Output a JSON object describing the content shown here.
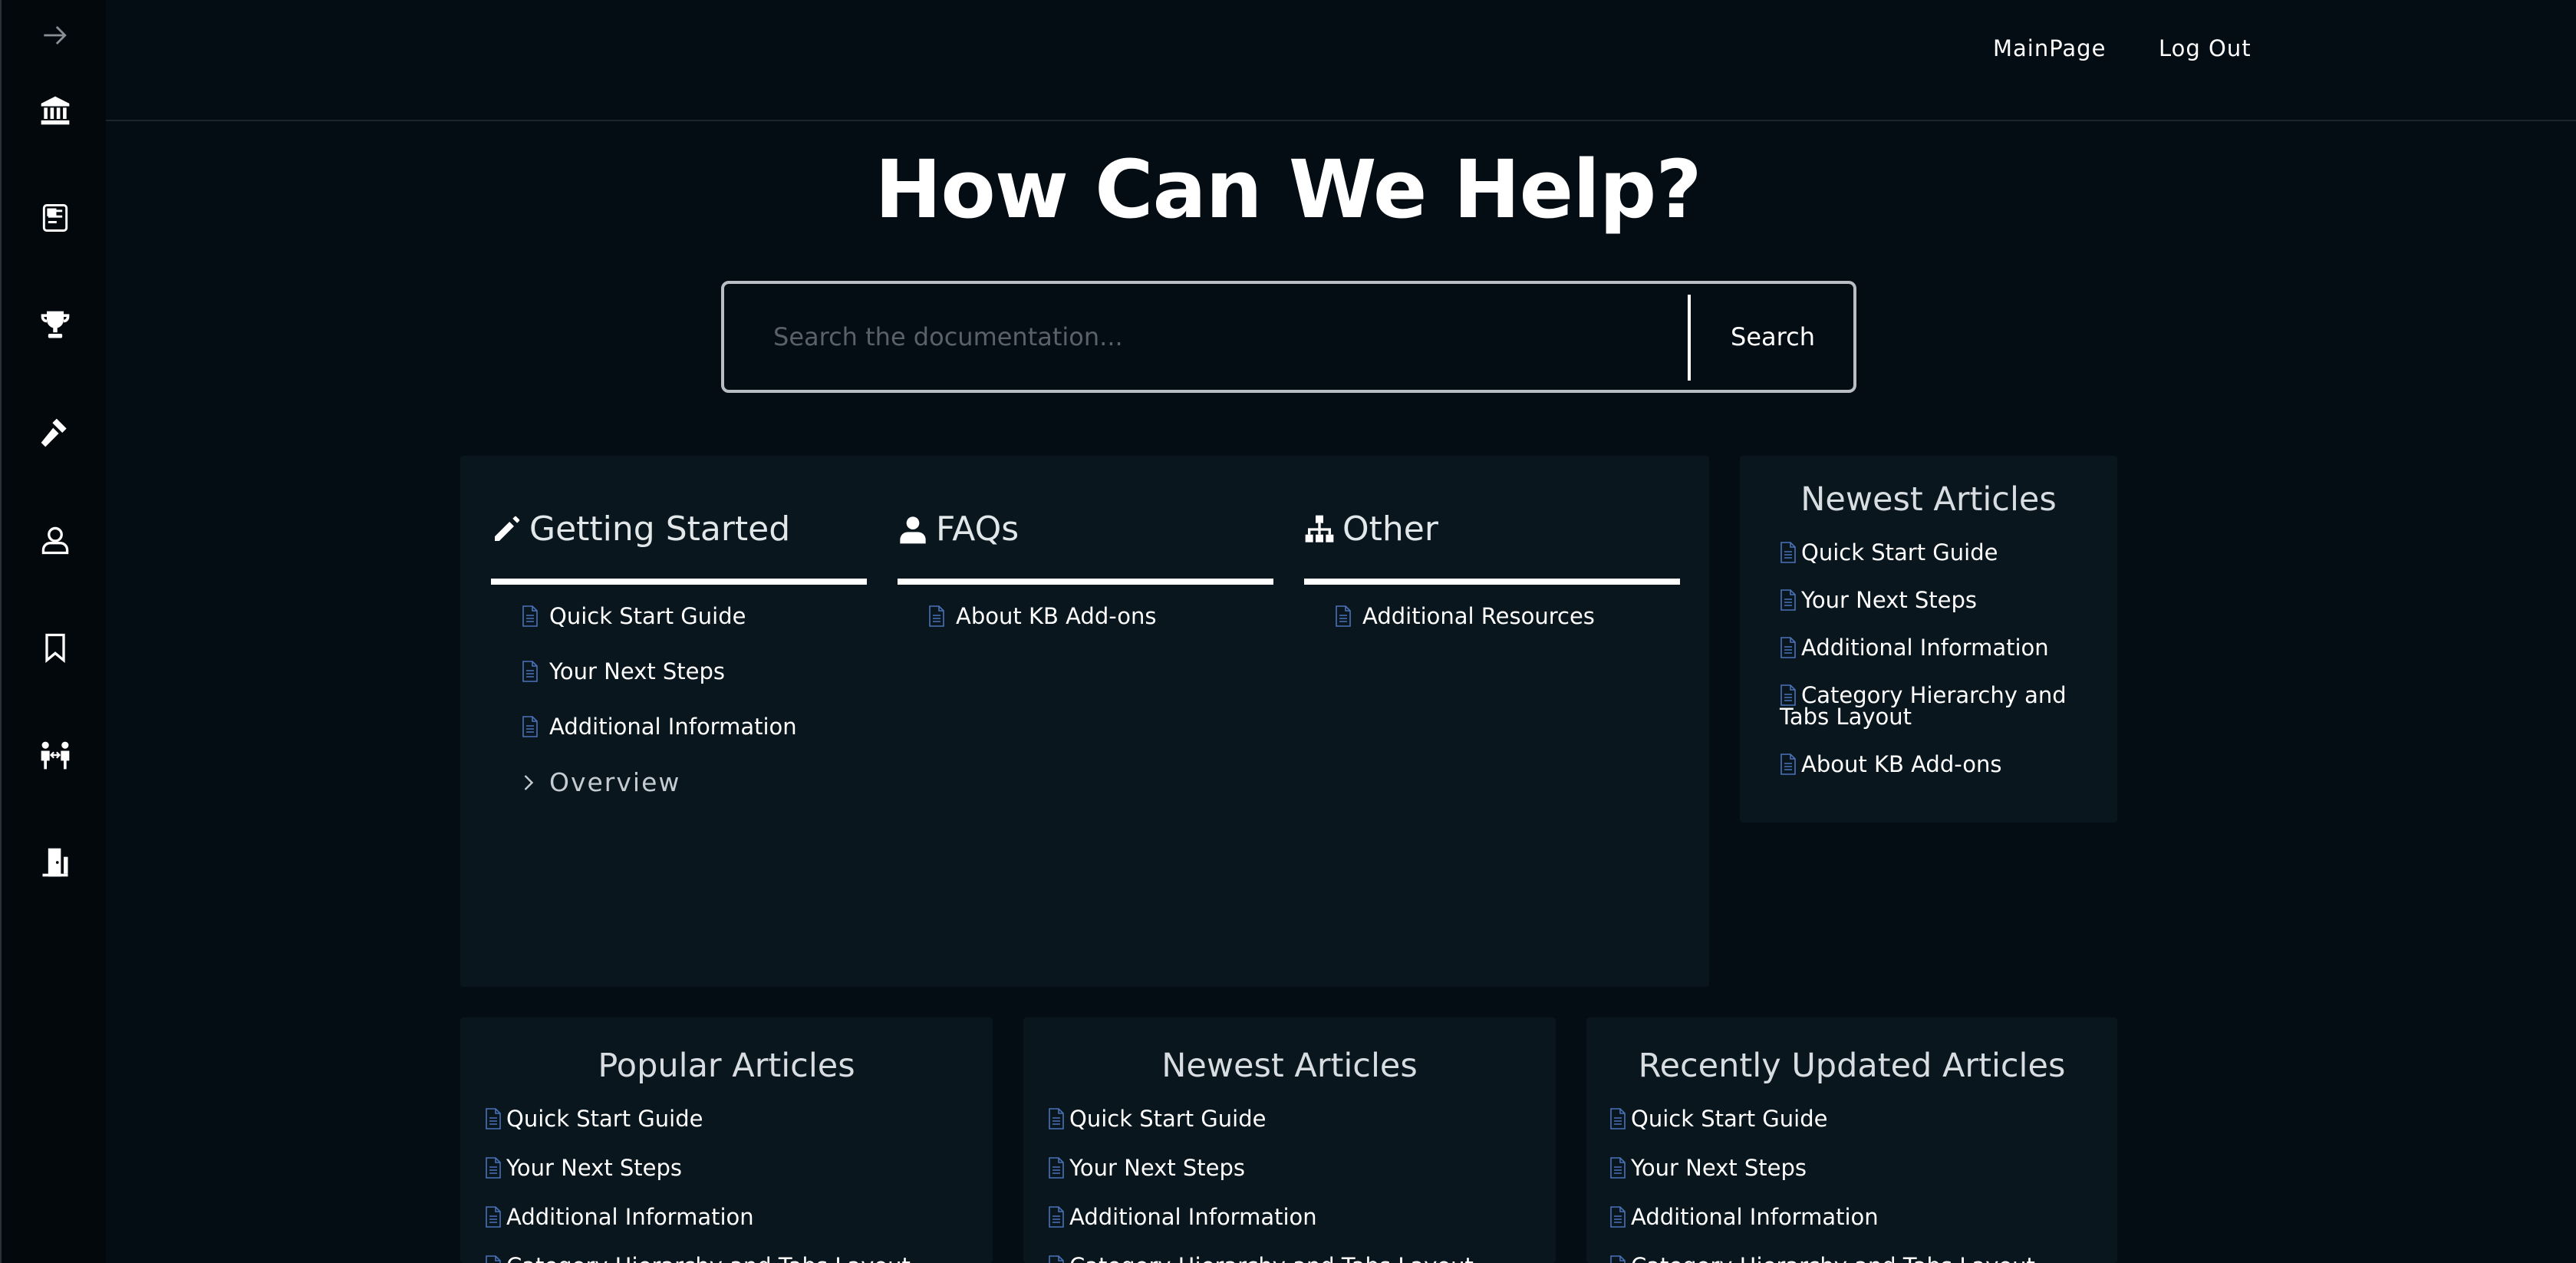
{
  "nav": {
    "main_page": "MainPage",
    "log_out": "Log Out"
  },
  "sidebar": {
    "icons": [
      "arrow-right-icon",
      "bank-icon",
      "newspaper-icon",
      "trophy-icon",
      "gavel-icon",
      "user-icon",
      "bookmark-icon",
      "people-exchange-icon",
      "exit-door-icon"
    ]
  },
  "hero": {
    "title": "How Can We Help?"
  },
  "search": {
    "placeholder": "Search the documentation...",
    "button_label": "Search"
  },
  "categories": [
    {
      "title": "Getting Started",
      "icon": "pencil-icon",
      "links": [
        "Quick Start Guide",
        "Your Next Steps",
        "Additional Information"
      ],
      "subcategory": "Overview"
    },
    {
      "title": "FAQs",
      "icon": "user-icon",
      "links": [
        "About KB Add-ons"
      ]
    },
    {
      "title": "Other",
      "icon": "sitemap-icon",
      "links": [
        "Additional Resources"
      ]
    }
  ],
  "side_newest": {
    "title": "Newest Articles",
    "items": [
      "Quick Start Guide",
      "Your Next Steps",
      "Additional Information",
      "Category Hierarchy and Tabs Layout",
      "About KB Add-ons"
    ]
  },
  "bottom_boxes": [
    {
      "title": "Popular Articles",
      "items": [
        "Quick Start Guide",
        "Your Next Steps",
        "Additional Information",
        "Category Hierarchy and Tabs Layout"
      ]
    },
    {
      "title": "Newest Articles",
      "items": [
        "Quick Start Guide",
        "Your Next Steps",
        "Additional Information",
        "Category Hierarchy and Tabs Layout"
      ]
    },
    {
      "title": "Recently Updated Articles",
      "items": [
        "Quick Start Guide",
        "Your Next Steps",
        "Additional Information",
        "Category Hierarchy and Tabs Layout"
      ]
    }
  ],
  "colors": {
    "background": "#040d14",
    "panel": "#09161d",
    "doc_icon": "#4a72b8",
    "text": "#ffffff"
  }
}
